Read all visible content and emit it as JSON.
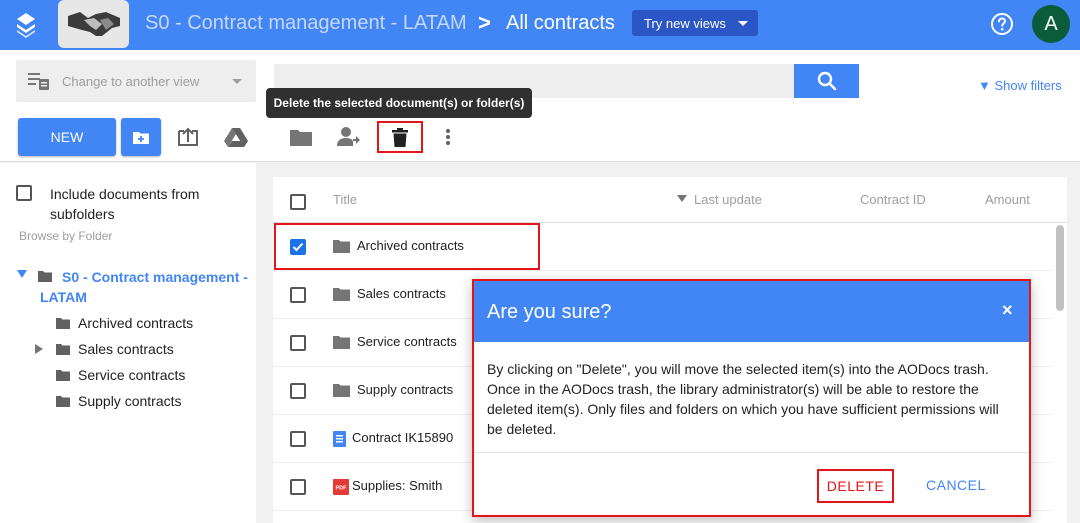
{
  "header": {
    "library_title": "S0 - Contract management - LATAM",
    "breadcrumb_separator": ">",
    "view_title": "All contracts",
    "try_new_views": "Try new views",
    "avatar_letter": "A",
    "bar_color": "#4285f4"
  },
  "view_bar": {
    "view_select_placeholder": "Change to another view",
    "search_value": "",
    "show_filters": "▼ Show filters"
  },
  "toolbar": {
    "new_label": "NEW",
    "tooltip": "Delete the selected document(s) or folder(s)"
  },
  "sidebar": {
    "include_subfolders": "Include documents from subfolders",
    "browse_by_folder": "Browse by Folder",
    "root": "S0 - Contract management - LATAM",
    "folders": [
      {
        "label": "Archived contracts"
      },
      {
        "label": "Sales contracts"
      },
      {
        "label": "Service contracts"
      },
      {
        "label": "Supply contracts"
      }
    ]
  },
  "table": {
    "columns": [
      "Title",
      "Last update",
      "Contract ID",
      "Amount"
    ],
    "rows": [
      {
        "title": "Archived contracts",
        "type": "folder-icon",
        "checked": true
      },
      {
        "title": "Sales contracts",
        "type": "folder-icon",
        "checked": false
      },
      {
        "title": "Service contracts",
        "type": "folder-icon",
        "checked": false
      },
      {
        "title": "Supply contracts",
        "type": "folder-icon",
        "checked": false
      },
      {
        "title": "Contract IK15890",
        "type": "google-doc-icon",
        "checked": false
      },
      {
        "title": "Supplies: Smith",
        "type": "pdf-icon",
        "checked": false
      }
    ]
  },
  "dialog": {
    "title": "Are you sure?",
    "close": "×",
    "body": "By clicking on \"Delete\", you will move the selected item(s) into the AODocs trash. Once in the AODocs trash, the library administrator(s) will be able to restore the deleted item(s). Only files and folders on which you have sufficient permissions will be deleted.",
    "delete_label": "DELETE",
    "cancel_label": "CANCEL"
  },
  "colors": {
    "accent": "#4285f4",
    "highlight_red": "#e3151a",
    "dark_button": "#2a56c6",
    "avatar_bg": "#0b5c3a"
  }
}
